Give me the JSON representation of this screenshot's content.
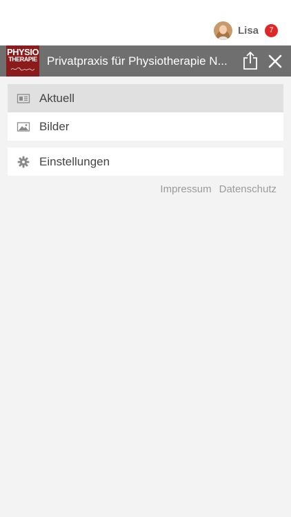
{
  "user": {
    "name": "Lisa",
    "notification_count": "7"
  },
  "header": {
    "title": "Privatpraxis für Physiotherapie N...",
    "logo_line1": "PHYSIO",
    "logo_line2": "THERAPIE"
  },
  "menu": {
    "group1": [
      {
        "label": "Aktuell",
        "icon": "news-icon",
        "active": true
      },
      {
        "label": "Bilder",
        "icon": "image-icon",
        "active": false
      }
    ],
    "group2": [
      {
        "label": "Einstellungen",
        "icon": "gear-icon",
        "active": false
      }
    ]
  },
  "footer": {
    "impressum": "Impressum",
    "datenschutz": "Datenschutz"
  },
  "colors": {
    "header_bg": "#6f6f6f",
    "logo_bg": "#8c1b1b",
    "badge": "#e02727",
    "active_item": "#e0e0e0",
    "page_bg": "#f3f3f3"
  }
}
